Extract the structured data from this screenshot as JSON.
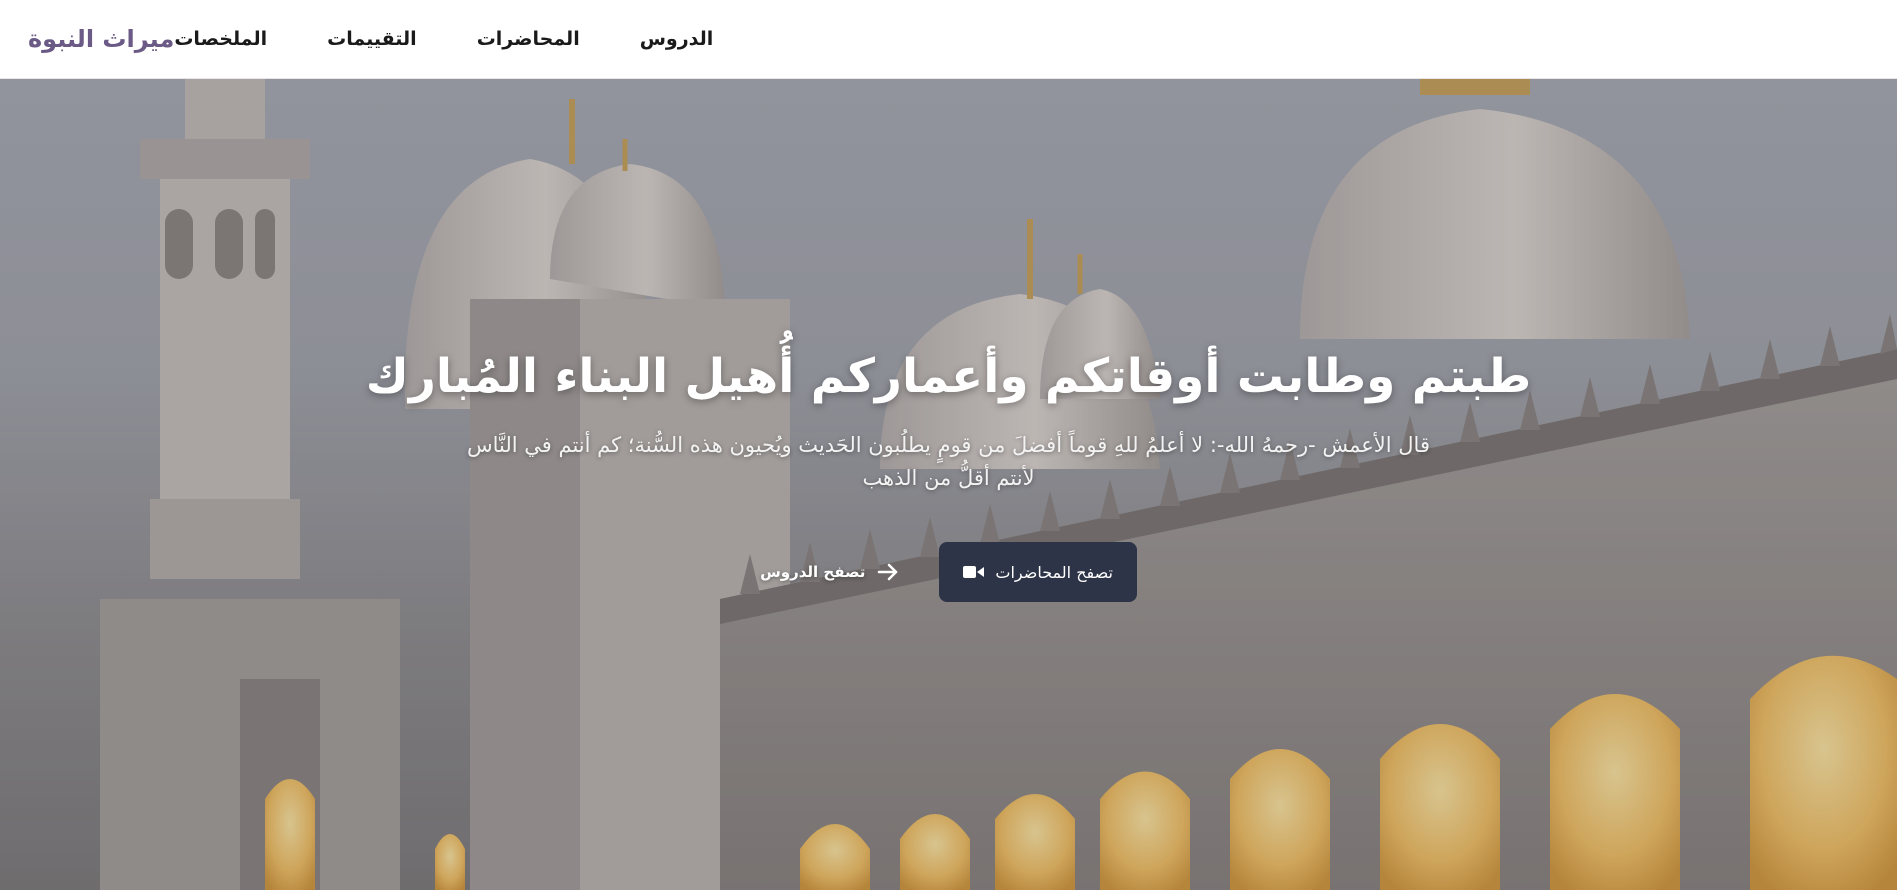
{
  "nav": {
    "brand": "ميراث النبوة",
    "links": [
      "الدروس",
      "المحاضرات",
      "التقييمات",
      "الملخصات"
    ]
  },
  "hero": {
    "title": "طبتم وطابت أوقاتكم وأعماركم أُهيل البناء المُبارك",
    "quote": "قال الأعمش -رحمهُ الله-: لا أعلمُ للهِ قوماً أفضلَ من قومٍ يطلُبون الحَديث ويُحيون هذه السُّنة؛ كم أنتم في النَّاس لأنتم أقلُّ من الذهب",
    "primary_button": {
      "label": "تصفح المحاضرات",
      "icon": "video-camera-icon"
    },
    "secondary_button": {
      "label": "تصفح الدروس",
      "icon": "arrow-right-icon"
    }
  },
  "colors": {
    "brand": "#6b5a86",
    "primary_button_bg": "#2d3447",
    "nav_text": "#1a1a1a",
    "hero_text": "#ffffff"
  }
}
